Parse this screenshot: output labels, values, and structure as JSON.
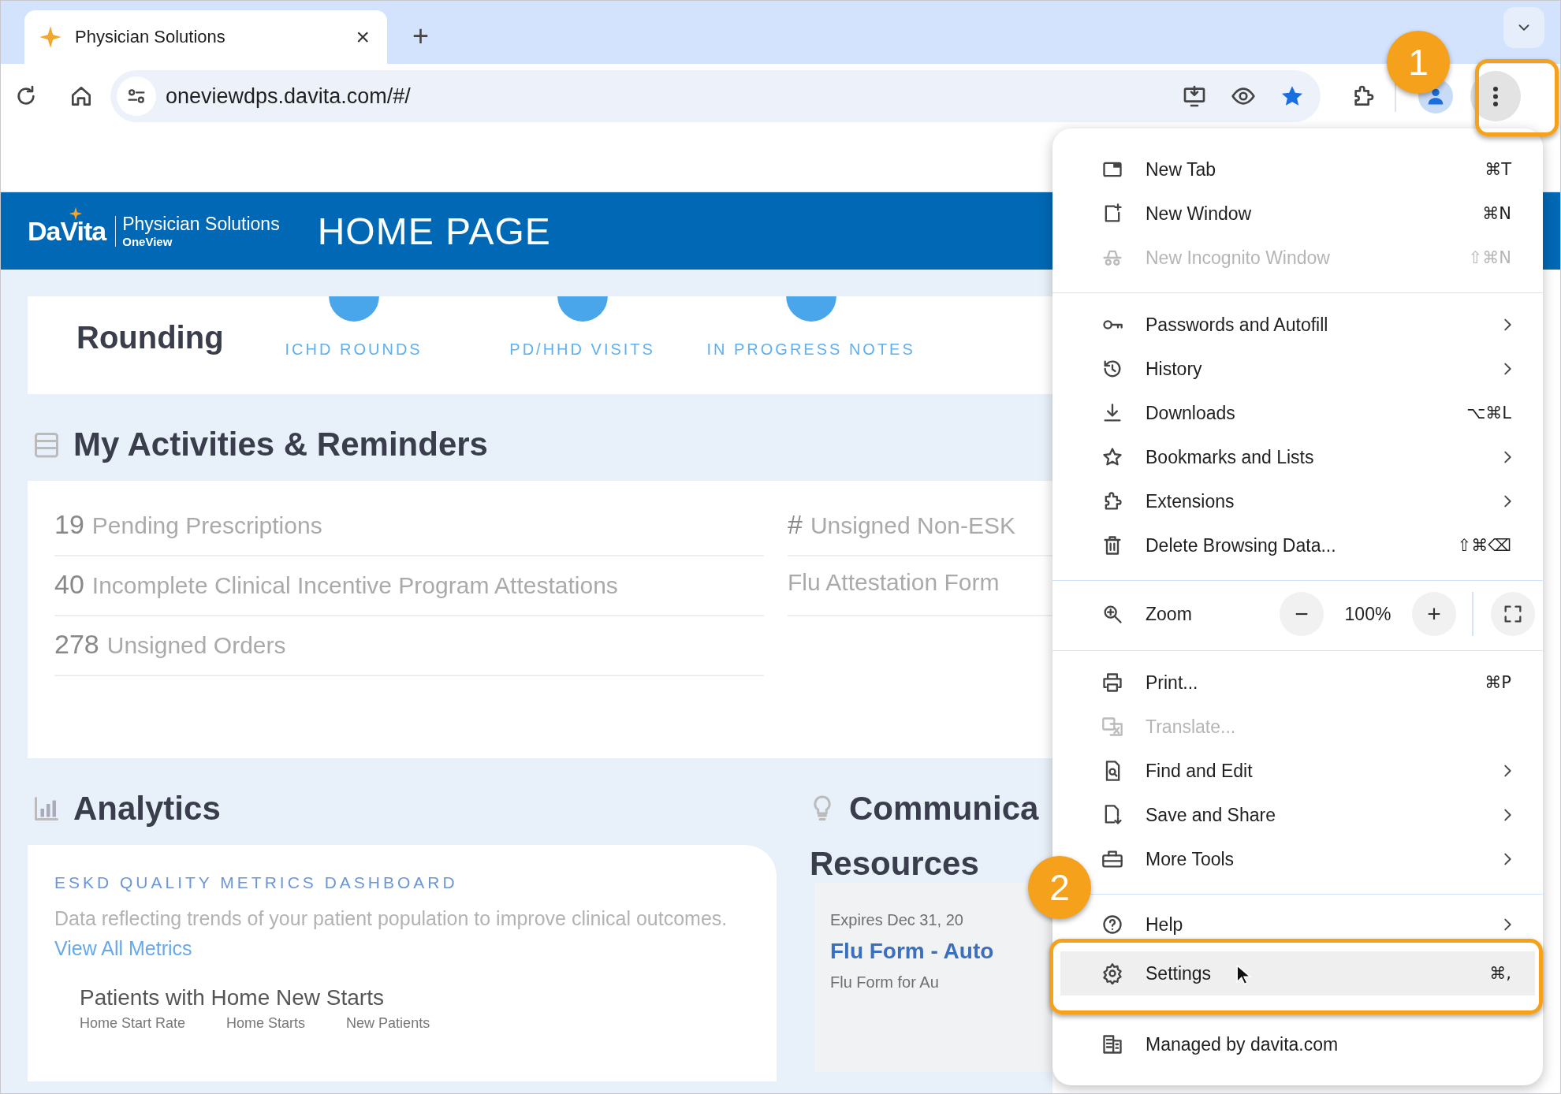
{
  "browser": {
    "tab": {
      "title": "Physician Solutions",
      "close": "×"
    },
    "new_tab": "+",
    "address": "oneviewdps.davita.com/#/"
  },
  "site": {
    "brand": "DaVita",
    "product": "Physician Solutions",
    "subproduct": "OneView",
    "title": "HOME PAGE"
  },
  "rounding": {
    "title": "Rounding",
    "links": [
      "ICHD ROUNDS",
      "PD/HHD VISITS",
      "IN PROGRESS NOTES"
    ]
  },
  "activities": {
    "title": "My Activities & Reminders",
    "left": [
      {
        "count": "19",
        "label": "Pending Prescriptions"
      },
      {
        "count": "40",
        "label": "Incomplete Clinical Incentive Program Attestations"
      },
      {
        "count": "278",
        "label": "Unsigned Orders"
      }
    ],
    "right": [
      {
        "count": "#",
        "label": "Unsigned Non-ESK"
      },
      {
        "label": "Flu Attestation Form"
      }
    ]
  },
  "analytics": {
    "title": "Analytics",
    "dashboard": "ESKD QUALITY METRICS DASHBOARD",
    "description": "Data reflecting trends of your patient population to improve clinical outcomes.",
    "link": "View All Metrics",
    "chart_title": "Patients with Home New Starts",
    "legend": [
      "Home Start Rate",
      "Home Starts",
      "New Patients"
    ]
  },
  "communications": {
    "title": "Communica",
    "subtitle": "Resources",
    "card": {
      "date": "Expires Dec 31, 20",
      "title": "Flu Form - Auto",
      "text": "Flu Form for Au"
    }
  },
  "menu": {
    "sections": [
      {
        "items": [
          {
            "kind": "item",
            "label": "New Tab",
            "shortcut": "⌘T",
            "disabled": false,
            "submenu": false,
            "selected": false
          },
          {
            "kind": "item",
            "label": "New Window",
            "shortcut": "⌘N",
            "disabled": false,
            "submenu": false,
            "selected": false
          },
          {
            "kind": "item",
            "label": "New Incognito Window",
            "shortcut": "⇧⌘N",
            "disabled": true,
            "submenu": false,
            "selected": false
          }
        ]
      },
      {
        "items": [
          {
            "kind": "item",
            "label": "Passwords and Autofill",
            "disabled": false,
            "submenu": true,
            "selected": false
          },
          {
            "kind": "item",
            "label": "History",
            "disabled": false,
            "submenu": true,
            "selected": false
          },
          {
            "kind": "item",
            "label": "Downloads",
            "shortcut": "⌥⌘L",
            "disabled": false,
            "submenu": false,
            "selected": false
          },
          {
            "kind": "item",
            "label": "Bookmarks and Lists",
            "disabled": false,
            "submenu": true,
            "selected": false
          },
          {
            "kind": "item",
            "label": "Extensions",
            "disabled": false,
            "submenu": true,
            "selected": false
          },
          {
            "kind": "item",
            "label": "Delete Browsing Data...",
            "shortcut": "⇧⌘⌫",
            "disabled": false,
            "submenu": false,
            "selected": false
          }
        ]
      },
      {
        "items": [
          {
            "kind": "zoom",
            "label": "Zoom",
            "minus": "−",
            "value": "100%",
            "plus": "+"
          }
        ]
      },
      {
        "items": [
          {
            "kind": "item",
            "label": "Print...",
            "shortcut": "⌘P",
            "disabled": false,
            "submenu": false,
            "selected": false
          },
          {
            "kind": "item",
            "label": "Translate...",
            "disabled": true,
            "submenu": false,
            "selected": false
          },
          {
            "kind": "item",
            "label": "Find and Edit",
            "disabled": false,
            "submenu": true,
            "selected": false
          },
          {
            "kind": "item",
            "label": "Save and Share",
            "disabled": false,
            "submenu": true,
            "selected": false
          },
          {
            "kind": "item",
            "label": "More Tools",
            "disabled": false,
            "submenu": true,
            "selected": false
          }
        ]
      },
      {
        "items": [
          {
            "kind": "item",
            "label": "Help",
            "disabled": false,
            "submenu": true,
            "selected": false
          },
          {
            "kind": "item",
            "label": "Settings",
            "shortcut": "⌘,",
            "disabled": false,
            "submenu": false,
            "selected": true
          },
          {
            "kind": "item",
            "label": "Managed by davita.com",
            "disabled": false,
            "submenu": false,
            "selected": false
          }
        ]
      }
    ]
  },
  "callouts": [
    {
      "number": "1"
    },
    {
      "number": "2"
    }
  ]
}
